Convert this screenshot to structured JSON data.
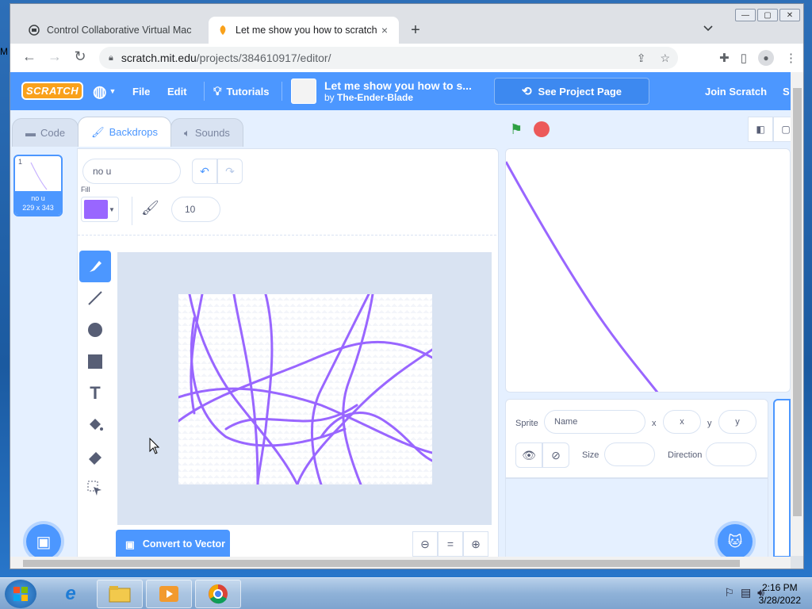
{
  "desktop": {
    "edge_text": "M"
  },
  "browser": {
    "tabs": [
      {
        "title": "Control Collaborative Virtual Mac",
        "close": "×",
        "active": false
      },
      {
        "title": "Let me show you how to scratch",
        "close": "×",
        "active": true
      }
    ],
    "new_tab": "+",
    "url_domain": "scratch.mit.edu",
    "url_path": "/projects/384610917/editor/"
  },
  "scratch_menu": {
    "logo": "SCRATCH",
    "file": "File",
    "edit": "Edit",
    "tutorials": "Tutorials",
    "project_title": "Let me show you how to s...",
    "project_author_prefix": "by",
    "project_author": "The-Ender-Blade",
    "see_project": "See Project Page",
    "join": "Join Scratch",
    "signin_partial": "S"
  },
  "editor_tabs": {
    "code": "Code",
    "backdrops": "Backdrops",
    "sounds": "Sounds"
  },
  "backdrop_list": [
    {
      "number": "1",
      "name": "no u",
      "size": "229 x 343"
    }
  ],
  "paint_editor": {
    "backdrop_name": "no u",
    "fill_label": "Fill",
    "fill_color": "#9966ff",
    "brush_size": "10",
    "convert_button": "Convert to Vector",
    "zoom_reset": "="
  },
  "sprite_info": {
    "sprite_label": "Sprite",
    "name_placeholder": "Name",
    "x_label": "x",
    "x_placeholder": "x",
    "y_label": "y",
    "y_placeholder": "y",
    "size_label": "Size",
    "direction_label": "Direction"
  },
  "taskbar": {
    "time": "2:16 PM",
    "date": "3/28/2022"
  },
  "colors": {
    "scratch_blue": "#4c97ff",
    "paint_purple": "#9966ff",
    "stop_red": "#ec5959"
  }
}
